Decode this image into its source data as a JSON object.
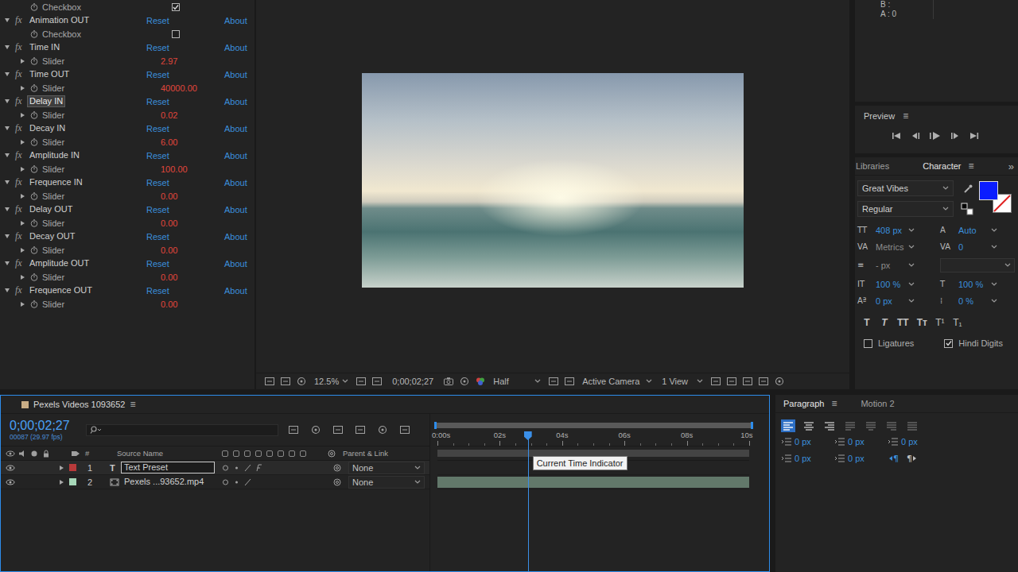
{
  "effect_controls": {
    "rows": [
      {
        "kind": "checkbox",
        "label": "Checkbox",
        "checked": true
      },
      {
        "kind": "effect",
        "fx": "fx",
        "label": "Animation OUT",
        "reset": "Reset",
        "about": "About",
        "expanded": true,
        "selected": false
      },
      {
        "kind": "checkbox",
        "label": "Checkbox",
        "checked": false
      },
      {
        "kind": "effect",
        "fx": "fx",
        "label": "Time IN",
        "reset": "Reset",
        "about": "About",
        "expanded": true,
        "selected": false
      },
      {
        "kind": "slider",
        "label": "Slider",
        "value": "2.97",
        "expanded": false
      },
      {
        "kind": "effect",
        "fx": "fx",
        "label": "Time OUT",
        "reset": "Reset",
        "about": "About",
        "expanded": true,
        "selected": false
      },
      {
        "kind": "slider",
        "label": "Slider",
        "value": "40000.00",
        "expanded": false
      },
      {
        "kind": "effect",
        "fx": "fx",
        "label": "Delay IN",
        "reset": "Reset",
        "about": "About",
        "expanded": true,
        "selected": true
      },
      {
        "kind": "slider",
        "label": "Slider",
        "value": "0.02",
        "expanded": false
      },
      {
        "kind": "effect",
        "fx": "fx",
        "label": "Decay IN",
        "reset": "Reset",
        "about": "About",
        "expanded": true,
        "selected": false
      },
      {
        "kind": "slider",
        "label": "Slider",
        "value": "6.00",
        "expanded": false
      },
      {
        "kind": "effect",
        "fx": "fx",
        "label": "Amplitude IN",
        "reset": "Reset",
        "about": "About",
        "expanded": true,
        "selected": false
      },
      {
        "kind": "slider",
        "label": "Slider",
        "value": "100.00",
        "expanded": false
      },
      {
        "kind": "effect",
        "fx": "fx",
        "label": "Frequence IN",
        "reset": "Reset",
        "about": "About",
        "expanded": true,
        "selected": false
      },
      {
        "kind": "slider",
        "label": "Slider",
        "value": "0.00",
        "expanded": false
      },
      {
        "kind": "effect",
        "fx": "fx",
        "label": "Delay OUT",
        "reset": "Reset",
        "about": "About",
        "expanded": true,
        "selected": false
      },
      {
        "kind": "slider",
        "label": "Slider",
        "value": "0.00",
        "expanded": false
      },
      {
        "kind": "effect",
        "fx": "fx",
        "label": "Decay OUT",
        "reset": "Reset",
        "about": "About",
        "expanded": true,
        "selected": false
      },
      {
        "kind": "slider",
        "label": "Slider",
        "value": "0.00",
        "expanded": false
      },
      {
        "kind": "effect",
        "fx": "fx",
        "label": "Amplitude OUT",
        "reset": "Reset",
        "about": "About",
        "expanded": true,
        "selected": false
      },
      {
        "kind": "slider",
        "label": "Slider",
        "value": "0.00",
        "expanded": false
      },
      {
        "kind": "effect",
        "fx": "fx",
        "label": "Frequence OUT",
        "reset": "Reset",
        "about": "About",
        "expanded": true,
        "selected": false
      },
      {
        "kind": "slider",
        "label": "Slider",
        "value": "0.00",
        "expanded": false
      }
    ]
  },
  "viewer": {
    "zoom": "12.5%",
    "timecode": "0;00;02;27",
    "resolution": "Half",
    "camera": "Active Camera",
    "views": "1 View"
  },
  "info": {
    "lines": [
      "B :",
      "A : 0"
    ]
  },
  "preview": {
    "title": "Preview",
    "menu": "≡"
  },
  "character": {
    "tabs": [
      {
        "label": "Libraries",
        "selected": false
      },
      {
        "label": "Character",
        "selected": true
      }
    ],
    "menu": "≡",
    "overflow": "»",
    "font": "Great Vibes",
    "style": "Regular",
    "fill_color": "#0b1dff",
    "field_groups": [
      [
        {
          "icon": "TT",
          "value": "408 px",
          "kind": "scrub"
        },
        {
          "icon": "A",
          "value": "Auto",
          "kind": "scrub"
        },
        {
          "icon": "VA",
          "value": "Metrics",
          "kind": "dropdown"
        },
        {
          "icon": "VA",
          "value": "0",
          "kind": "scrub"
        }
      ],
      [
        {
          "icon": "≡",
          "value": "- px",
          "kind": "dropdown"
        },
        {
          "kind": "select"
        }
      ],
      [
        {
          "icon": "IT",
          "value": "100 %",
          "kind": "scrub"
        },
        {
          "icon": "T",
          "value": "100 %",
          "kind": "scrub"
        },
        {
          "icon": "Aª",
          "value": "0 px",
          "kind": "scrub"
        },
        {
          "icon": "⁞",
          "value": "0 %",
          "kind": "scrub"
        }
      ]
    ],
    "style_buttons": [
      {
        "label": "T",
        "kind": "bold"
      },
      {
        "label": "T",
        "kind": "italic"
      },
      {
        "label": "TT",
        "kind": "caps"
      },
      {
        "label": "Tт",
        "kind": "smallcaps"
      },
      {
        "label": "T¹",
        "kind": "super"
      },
      {
        "label": "T₁",
        "kind": "sub"
      }
    ],
    "options": [
      {
        "label": "Ligatures",
        "checked": false
      },
      {
        "label": "Hindi Digits",
        "checked": true
      }
    ]
  },
  "timeline": {
    "tab": "Pexels Videos 1093652",
    "menu": "≡",
    "timecode": "0;00;02;27",
    "frame_info": "00087 (29.97 fps)",
    "columns": {
      "number": "#",
      "source": "Source Name",
      "parent": "Parent & Link"
    },
    "ruler": [
      "0:00s",
      "02s",
      "04s",
      "06s",
      "08s",
      "10s"
    ],
    "cti_level": 0.29,
    "tooltip": "Current Time Indicator",
    "layers": [
      {
        "number": "1",
        "name": "Text Preset",
        "kind": "text",
        "icon": "T",
        "color": "#b83a3a",
        "selected": true,
        "expanded": false,
        "parent": "None",
        "has_bar": false
      },
      {
        "number": "2",
        "name": "Pexels ...93652.mp4",
        "kind": "footage",
        "color": "#a6d7b8",
        "selected": false,
        "expanded": false,
        "parent": "None",
        "has_bar": true
      }
    ]
  },
  "paragraph": {
    "tabs": [
      {
        "label": "Paragraph",
        "selected": true
      },
      {
        "label": "Motion 2",
        "selected": false
      }
    ],
    "menu": "≡",
    "align": [
      {
        "kind": "left",
        "selected": true,
        "disabled": false
      },
      {
        "kind": "center",
        "selected": false,
        "disabled": false
      },
      {
        "kind": "right",
        "selected": false,
        "disabled": false
      },
      {
        "kind": "justify-left",
        "selected": false,
        "disabled": true
      },
      {
        "kind": "justify-center",
        "selected": false,
        "disabled": true
      },
      {
        "kind": "justify-right",
        "selected": false,
        "disabled": true
      },
      {
        "kind": "justify-all",
        "selected": false,
        "disabled": true
      }
    ],
    "indent_rows": [
      [
        "0 px",
        "0 px",
        "0 px"
      ],
      [
        "0 px",
        "0 px"
      ]
    ],
    "directions": [
      {
        "label": "¶",
        "selected": true
      },
      {
        "label": "¶",
        "selected": false
      }
    ]
  }
}
